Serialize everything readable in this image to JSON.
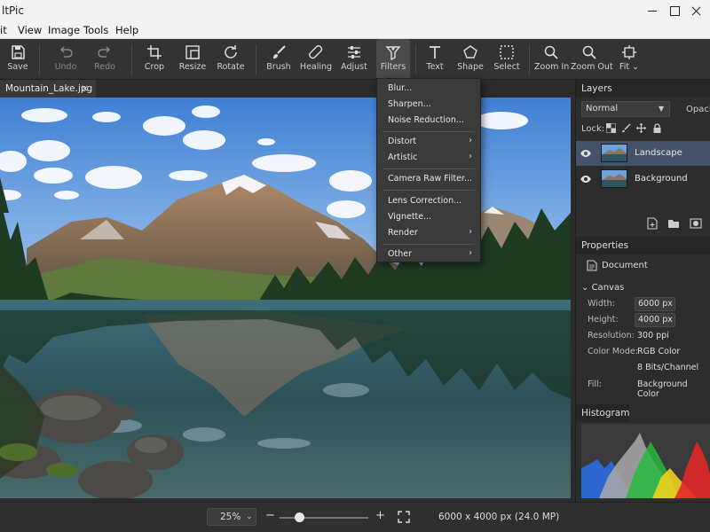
{
  "app": {
    "title": "ltPic"
  },
  "menu": [
    "it",
    "View",
    "Image",
    "Tools",
    "Help"
  ],
  "toolbar": [
    {
      "id": "save",
      "label": "Save",
      "icon": "save-icon",
      "disabled": false
    },
    {
      "id": "undo",
      "label": "Undo",
      "icon": "undo-icon",
      "disabled": true
    },
    {
      "id": "redo",
      "label": "Redo",
      "icon": "redo-icon",
      "disabled": true
    },
    {
      "id": "crop",
      "label": "Crop",
      "icon": "crop-icon",
      "disabled": false
    },
    {
      "id": "resize",
      "label": "Resize",
      "icon": "resize-icon",
      "disabled": false
    },
    {
      "id": "rotate",
      "label": "Rotate",
      "icon": "rotate-icon",
      "disabled": false
    },
    {
      "id": "brush",
      "label": "Brush",
      "icon": "brush-icon",
      "disabled": false
    },
    {
      "id": "healing",
      "label": "Healing",
      "icon": "healing-icon",
      "disabled": false
    },
    {
      "id": "adjust",
      "label": "Adjust",
      "icon": "adjust-icon",
      "disabled": false
    },
    {
      "id": "filters",
      "label": "Filters",
      "icon": "filters-icon",
      "disabled": false,
      "active": true
    },
    {
      "id": "text",
      "label": "Text",
      "icon": "text-icon",
      "disabled": false
    },
    {
      "id": "shape",
      "label": "Shape",
      "icon": "shape-icon",
      "disabled": false
    },
    {
      "id": "select",
      "label": "Select",
      "icon": "select-icon",
      "disabled": false
    },
    {
      "id": "zoomin",
      "label": "Zoom In",
      "icon": "zoom-in-icon",
      "disabled": false
    },
    {
      "id": "zoomout",
      "label": "Zoom Out",
      "icon": "zoom-out-icon",
      "disabled": false
    },
    {
      "id": "fit",
      "label": "Fit",
      "icon": "fit-icon",
      "disabled": false,
      "dropdown": true
    }
  ],
  "tab": {
    "filename": "Mountain_Lake.jpg",
    "close": "×"
  },
  "filters_menu": {
    "items": [
      {
        "label": "Blur...",
        "submenu": false
      },
      {
        "label": "Sharpen...",
        "submenu": false
      },
      {
        "label": "Noise Reduction...",
        "submenu": false
      },
      {
        "label": "Distort",
        "submenu": true
      },
      {
        "label": "Artistic",
        "submenu": true
      },
      {
        "label": "Camera Raw Filter...",
        "submenu": false
      },
      {
        "label": "Lens Correction...",
        "submenu": false
      },
      {
        "label": "Vignette...",
        "submenu": false
      },
      {
        "label": "Render",
        "submenu": true
      },
      {
        "label": "Other",
        "submenu": true
      }
    ],
    "submenu_glyph": "›"
  },
  "layers_panel": {
    "title": "Layers",
    "blend_mode": "Normal",
    "opacity_label": "Opacity",
    "lock_label": "Lock:",
    "layers": [
      {
        "name": "Landscape",
        "visible": true,
        "selected": true
      },
      {
        "name": "Background",
        "visible": true,
        "selected": false
      }
    ]
  },
  "properties_panel": {
    "title": "Properties",
    "document_label": "Document",
    "canvas_section": "Canvas",
    "width_label": "Width:",
    "width_value": "6000 px",
    "height_label": "Height:",
    "height_value": "4000 px",
    "resolution_label": "Resolution:",
    "resolution_value": "300 ppi",
    "color_mode_label": "Color Mode:",
    "color_mode_value": "RGB Color",
    "bit_depth": "8 Bits/Channel",
    "fill_label": "Fill:",
    "fill_value": "Background Color"
  },
  "histogram": {
    "title": "Histogram"
  },
  "status": {
    "zoom": "25%",
    "zoom_slider": 0.22,
    "minus": "−",
    "plus": "+",
    "doc_info": "6000 x 4000 px (24.0 MP)"
  },
  "colors": {
    "accent_selected_layer": "#45536a",
    "panel_bg": "#2d2d2d",
    "toolbar_bg": "#333333"
  }
}
